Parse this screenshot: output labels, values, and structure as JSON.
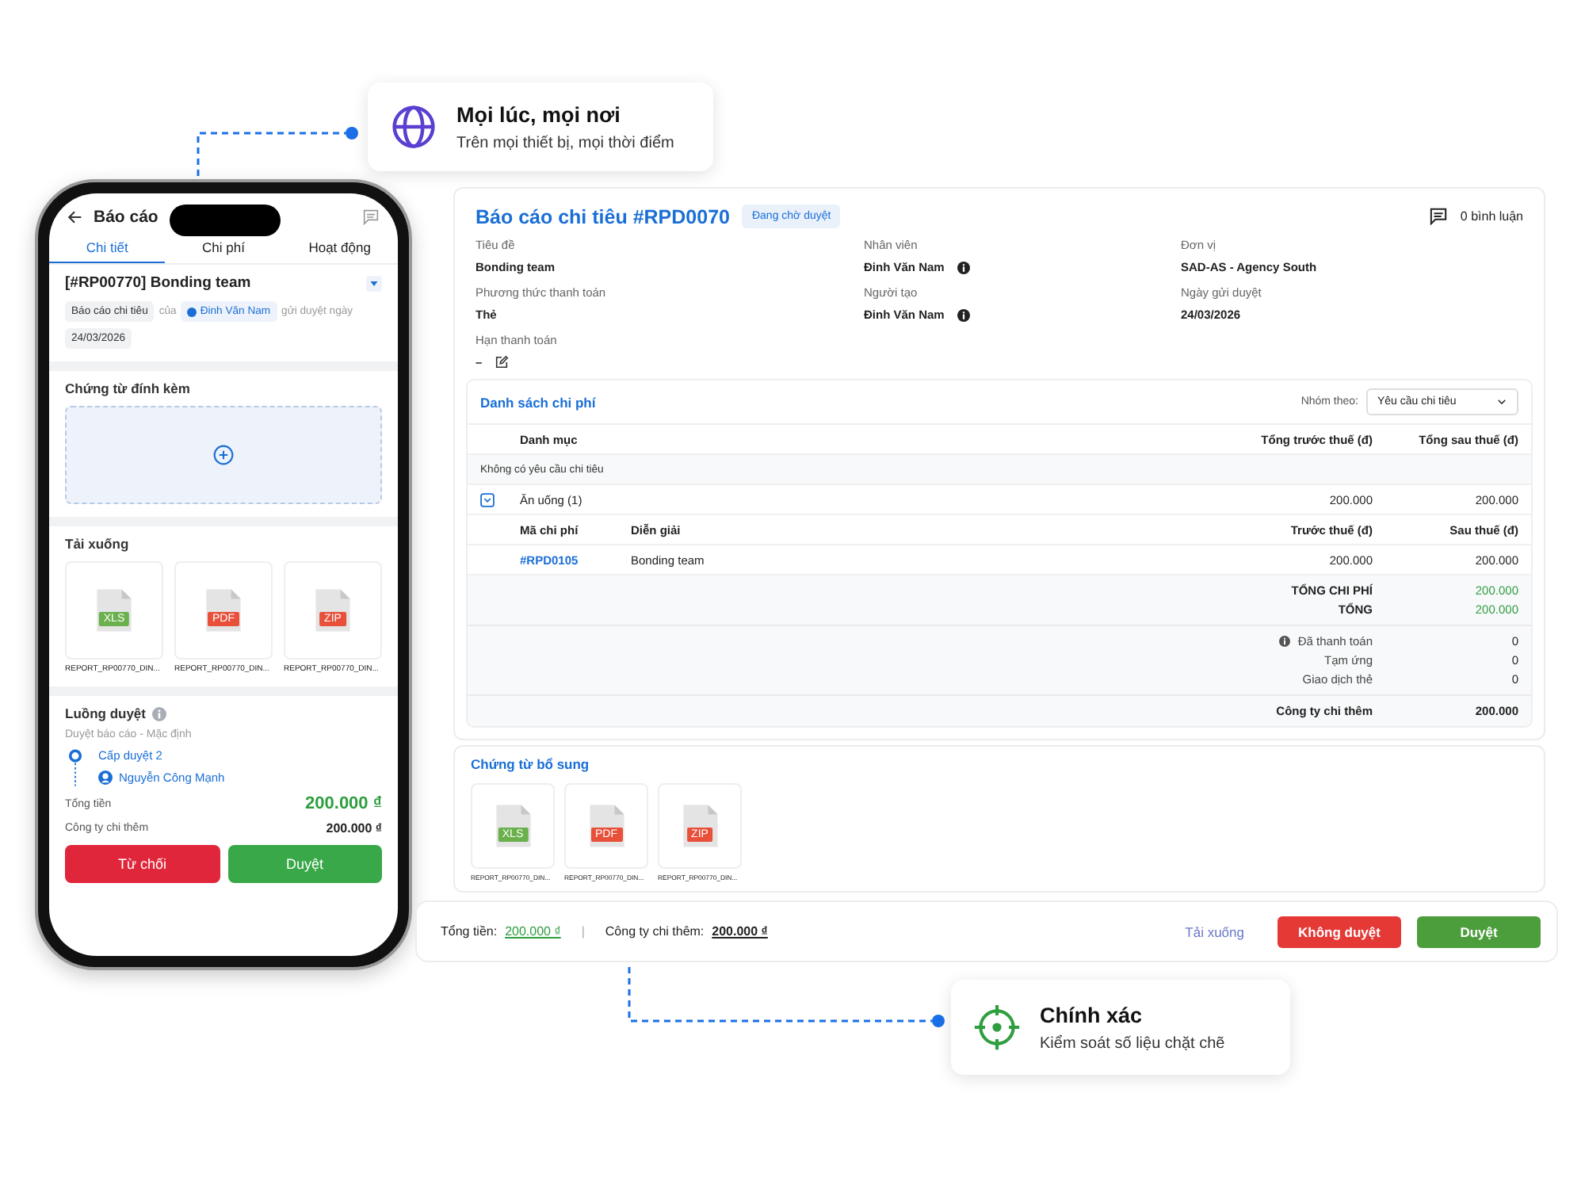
{
  "callouts": [
    {
      "kind": "globe",
      "title": "Mọi lúc, mọi nơi",
      "subtitle": "Trên mọi thiết bị, mọi thời điểm"
    },
    {
      "kind": "target",
      "title": "Chính xác",
      "subtitle": "Kiểm soát số liệu chặt chẽ"
    }
  ],
  "mobile": {
    "title": "Báo cáo",
    "tabs": [
      {
        "label": "Chi tiết",
        "selected": true
      },
      {
        "label": "Chi phí",
        "selected": false
      },
      {
        "label": "Hoạt động",
        "selected": false
      }
    ],
    "report_title": "[#RP00770] Bonding team",
    "meta": {
      "type": "Báo cáo chi tiêu",
      "of": "của",
      "employee": "Đinh Văn Nam",
      "sent": "gửi duyệt ngày",
      "date": "24/03/2026"
    },
    "attachments_title": "Chứng từ đính kèm",
    "downloads_title": "Tải xuống",
    "files": [
      {
        "type": "XLS",
        "color": "#6ab04c",
        "name": "REPORT_RP00770_DIN..."
      },
      {
        "type": "PDF",
        "color": "#e8503a",
        "name": "REPORT_RP00770_DIN..."
      },
      {
        "type": "ZIP",
        "color": "#e8503a",
        "name": "REPORT_RP00770_DIN..."
      }
    ],
    "approval": {
      "title": "Luồng duyệt",
      "flow": "Duyệt báo cáo - Mặc định",
      "step": "Cấp duyệt 2",
      "approver": "Nguyễn Công Mạnh"
    },
    "totals": [
      {
        "label": "Tổng tiền",
        "value": "200.000 ₫",
        "kind": "main"
      },
      {
        "label": "Công ty chi thêm",
        "value": "200.000 ₫",
        "kind": "plain"
      }
    ],
    "buttons": [
      {
        "label": "Từ chối",
        "kind": "reject"
      },
      {
        "label": "Duyệt",
        "kind": "approve"
      }
    ]
  },
  "report": {
    "title": "Báo cáo chi tiêu #RPD0070",
    "status": "Đang chờ duyệt",
    "comments": "0 bình luận",
    "fields": [
      {
        "label": "Tiêu đề",
        "value": "Bonding team"
      },
      {
        "label": "Nhân viên",
        "value": "Đinh Văn Nam",
        "info": true
      },
      {
        "label": "Đơn vị",
        "value": "SAD-AS - Agency South"
      },
      {
        "label": "Phương thức thanh toán",
        "value": "Thẻ"
      },
      {
        "label": "Người tạo",
        "value": "Đinh Văn Nam",
        "info": true
      },
      {
        "label": "Ngày gửi duyệt",
        "value": "24/03/2026"
      },
      {
        "label": "Hạn thanh toán",
        "value": "–",
        "editable": true
      }
    ]
  },
  "expenses": {
    "title": "Danh sách chi phí",
    "group_label": "Nhóm theo:",
    "group_value": "Yêu cầu chi tiêu",
    "columns": [
      "Danh mục",
      "Tổng trước thuế (đ)",
      "Tổng sau thuế (đ)"
    ],
    "empty_note": "Không có yêu cầu chi tiêu",
    "category": {
      "name": "Ăn uống (1)",
      "expanded": true,
      "before": "200.000",
      "after": "200.000"
    },
    "sub_columns": [
      "Mã chi phí",
      "Diễn giải",
      "Trước thuế (đ)",
      "Sau thuế (đ)"
    ],
    "rows": [
      {
        "code": "#RPD0105",
        "desc": "Bonding team",
        "before": "200.000",
        "after": "200.000"
      }
    ],
    "totals": [
      {
        "label": "TỔNG CHI PHÍ",
        "value": "200.000"
      },
      {
        "label": "TỔNG",
        "value": "200.000"
      }
    ],
    "payments": [
      {
        "label": "Đã thanh toán",
        "value": "0",
        "info": true
      },
      {
        "label": "Tạm ứng",
        "value": "0"
      },
      {
        "label": "Giao dịch thẻ",
        "value": "0"
      }
    ],
    "company": {
      "label": "Công ty chi thêm",
      "value": "200.000"
    }
  },
  "supporting": {
    "title": "Chứng từ bổ sung",
    "files": [
      {
        "type": "XLS",
        "color": "#6ab04c",
        "name": "REPORT_RP00770_DIN..."
      },
      {
        "type": "PDF",
        "color": "#e8503a",
        "name": "REPORT_RP00770_DIN..."
      },
      {
        "type": "ZIP",
        "color": "#e8503a",
        "name": "REPORT_RP00770_DIN..."
      }
    ]
  },
  "footer": {
    "total_label": "Tổng tiền:",
    "total": "200.000 ₫",
    "separator": "|",
    "company_label": "Công ty chi thêm:",
    "company": "200.000 ₫",
    "download": "Tải xuống",
    "reject": "Không duyệt",
    "approve": "Duyệt"
  }
}
